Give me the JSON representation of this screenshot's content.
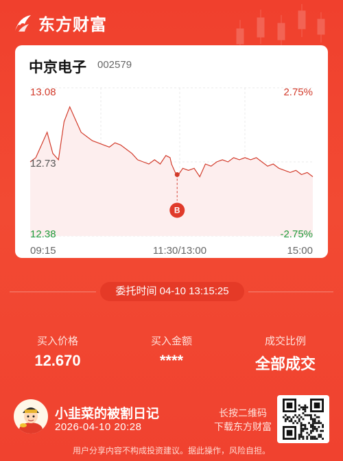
{
  "brand": {
    "name": "东方财富"
  },
  "stock": {
    "name": "中京电子",
    "code": "002579"
  },
  "chart_data": {
    "type": "line",
    "y_prices": {
      "top": "13.08",
      "mid": "12.73",
      "bottom": "12.38"
    },
    "y_pct": {
      "top": "2.75%",
      "bottom": "-2.75%"
    },
    "x_ticks": [
      "09:15",
      "11:30/13:00",
      "15:00"
    ],
    "ylim": [
      12.38,
      13.08
    ],
    "prev_close": 12.73,
    "line_color": "#d23a2a",
    "fill_color": "#fdeeee",
    "x": [
      0,
      2,
      4,
      6,
      8,
      10,
      12,
      14,
      16,
      18,
      20,
      22,
      24,
      26,
      28,
      30,
      32,
      34,
      36,
      38,
      40,
      42,
      44,
      46,
      48,
      49.5,
      50,
      52,
      54,
      56,
      58,
      60,
      62,
      64,
      66,
      68,
      70,
      72,
      74,
      76,
      78,
      80,
      82,
      84,
      86,
      88,
      90,
      92,
      94,
      96,
      98,
      100
    ],
    "values": [
      12.73,
      12.75,
      12.81,
      12.87,
      12.77,
      12.74,
      12.92,
      12.99,
      12.93,
      12.87,
      12.85,
      12.83,
      12.82,
      12.81,
      12.8,
      12.82,
      12.81,
      12.79,
      12.77,
      12.74,
      12.73,
      12.72,
      12.74,
      12.72,
      12.76,
      12.75,
      12.72,
      12.66,
      12.7,
      12.69,
      12.7,
      12.66,
      12.72,
      12.71,
      12.73,
      12.74,
      12.73,
      12.75,
      12.74,
      12.75,
      12.74,
      12.75,
      12.73,
      12.71,
      12.72,
      12.7,
      12.69,
      12.68,
      12.69,
      12.67,
      12.68,
      12.66
    ],
    "buy_marker": {
      "x": 52,
      "value": 12.67,
      "label": "B"
    }
  },
  "entrust_time": "委托时间 04-10 13:15:25",
  "stats": [
    {
      "label": "买入价格",
      "value": "12.670"
    },
    {
      "label": "买入金额",
      "value": "****"
    },
    {
      "label": "成交比例",
      "value": "全部成交"
    }
  ],
  "user": {
    "nickname": "小韭菜的被割日记",
    "date": "2026-04-10 20:28"
  },
  "download": {
    "line1": "长按二维码",
    "line2": "下载东方财富"
  },
  "disclaimer": "用户分享内容不构成投资建议。据此操作，风险自担。"
}
